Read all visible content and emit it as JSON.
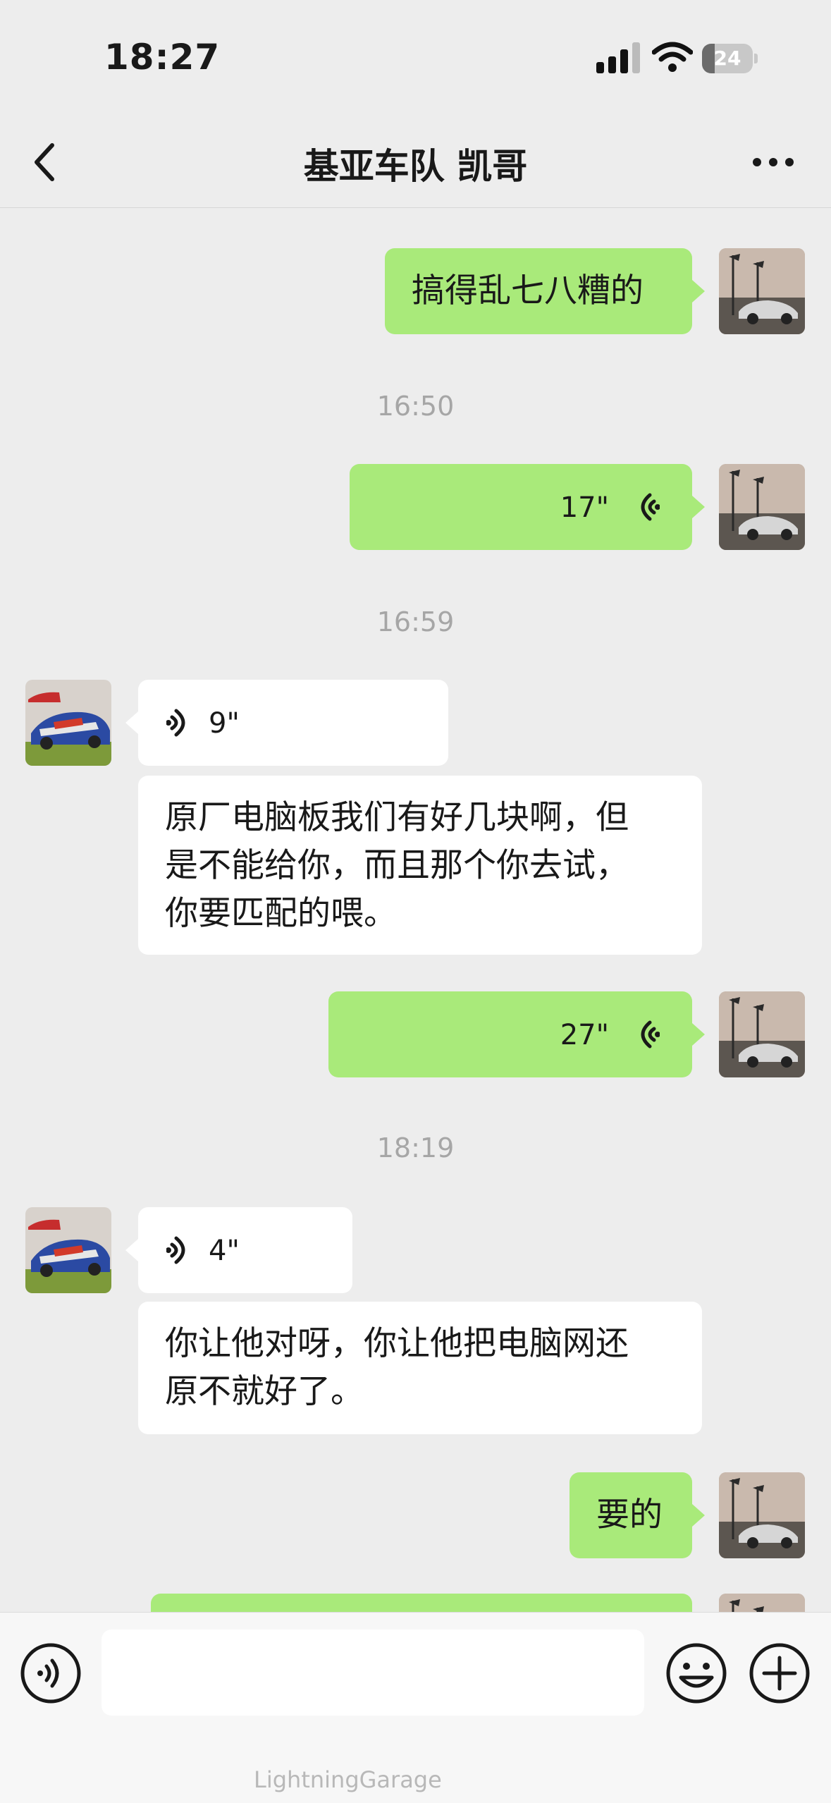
{
  "status_bar": {
    "time": "18:27",
    "battery": "24"
  },
  "header": {
    "title": "基亚车队 凯哥"
  },
  "messages": {
    "m1": "搞得乱七八糟的",
    "t1": "16:50",
    "v1": "17\"",
    "t2": "16:59",
    "v2": "9\"",
    "m2_line1": "原厂电脑板我们有好几块啊，但",
    "m2_line2": "是不能给你，而且那个你去试，",
    "m2_line3": "你要匹配的喂。",
    "v3": "27\"",
    "t3": "18:19",
    "v4": "4\"",
    "m3_line1": "你让他对呀，你让他把电脑网还",
    "m3_line2": "原不就好了。",
    "m4": "要的"
  },
  "watermark": "LightningGarage",
  "colors": {
    "my_bubble": "#a9ea7a",
    "other_bubble": "#ffffff",
    "background": "#ededed"
  }
}
